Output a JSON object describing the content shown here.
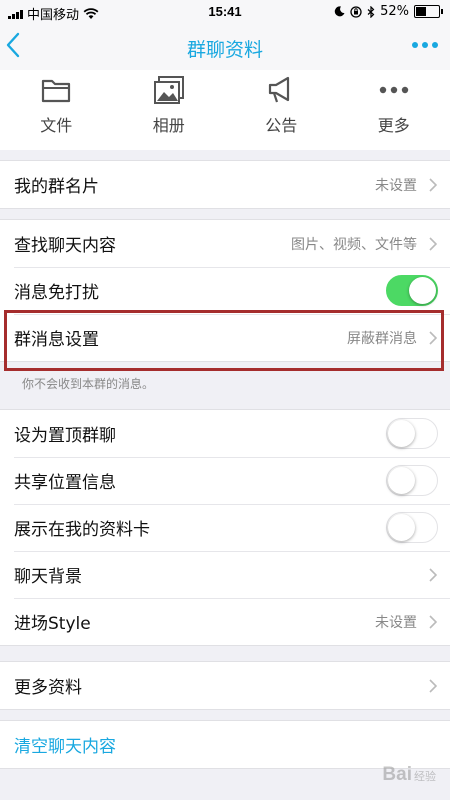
{
  "status_bar": {
    "carrier": "中国移动",
    "time": "15:41",
    "battery": "52%",
    "battery_level": 0.52
  },
  "nav": {
    "title": "群聊资料",
    "back_icon": "chevron-left-icon",
    "more_icon": "more-horizontal-icon",
    "accent_color": "#19a8e0"
  },
  "actions": [
    {
      "label": "文件",
      "icon": "folder-icon"
    },
    {
      "label": "相册",
      "icon": "photo-album-icon"
    },
    {
      "label": "公告",
      "icon": "megaphone-icon"
    },
    {
      "label": "更多",
      "icon": "more-dots-icon"
    }
  ],
  "rows": {
    "group_card": {
      "title": "我的群名片",
      "value": "未设置"
    },
    "search_chat": {
      "title": "查找聊天内容",
      "value": "图片、视频、文件等"
    },
    "do_not_disturb": {
      "title": "消息免打扰",
      "on": true
    },
    "message_settings": {
      "title": "群消息设置",
      "value": "屏蔽群消息"
    },
    "pin_chat": {
      "title": "设为置顶群聊",
      "on": false
    },
    "share_location": {
      "title": "共享位置信息",
      "on": false
    },
    "show_on_profile": {
      "title": "展示在我的资料卡",
      "on": false
    },
    "chat_background": {
      "title": "聊天背景"
    },
    "entry_style": {
      "title": "进场Style",
      "value": "未设置"
    },
    "more_info": {
      "title": "更多资料"
    },
    "clear_history": {
      "title": "清空聊天内容"
    }
  },
  "hint": "你不会收到本群的消息。",
  "watermark": {
    "text": "Bai",
    "sub": "经验"
  },
  "colors": {
    "toggle_on": "#4cd964",
    "highlight_border": "#a52d2d"
  }
}
